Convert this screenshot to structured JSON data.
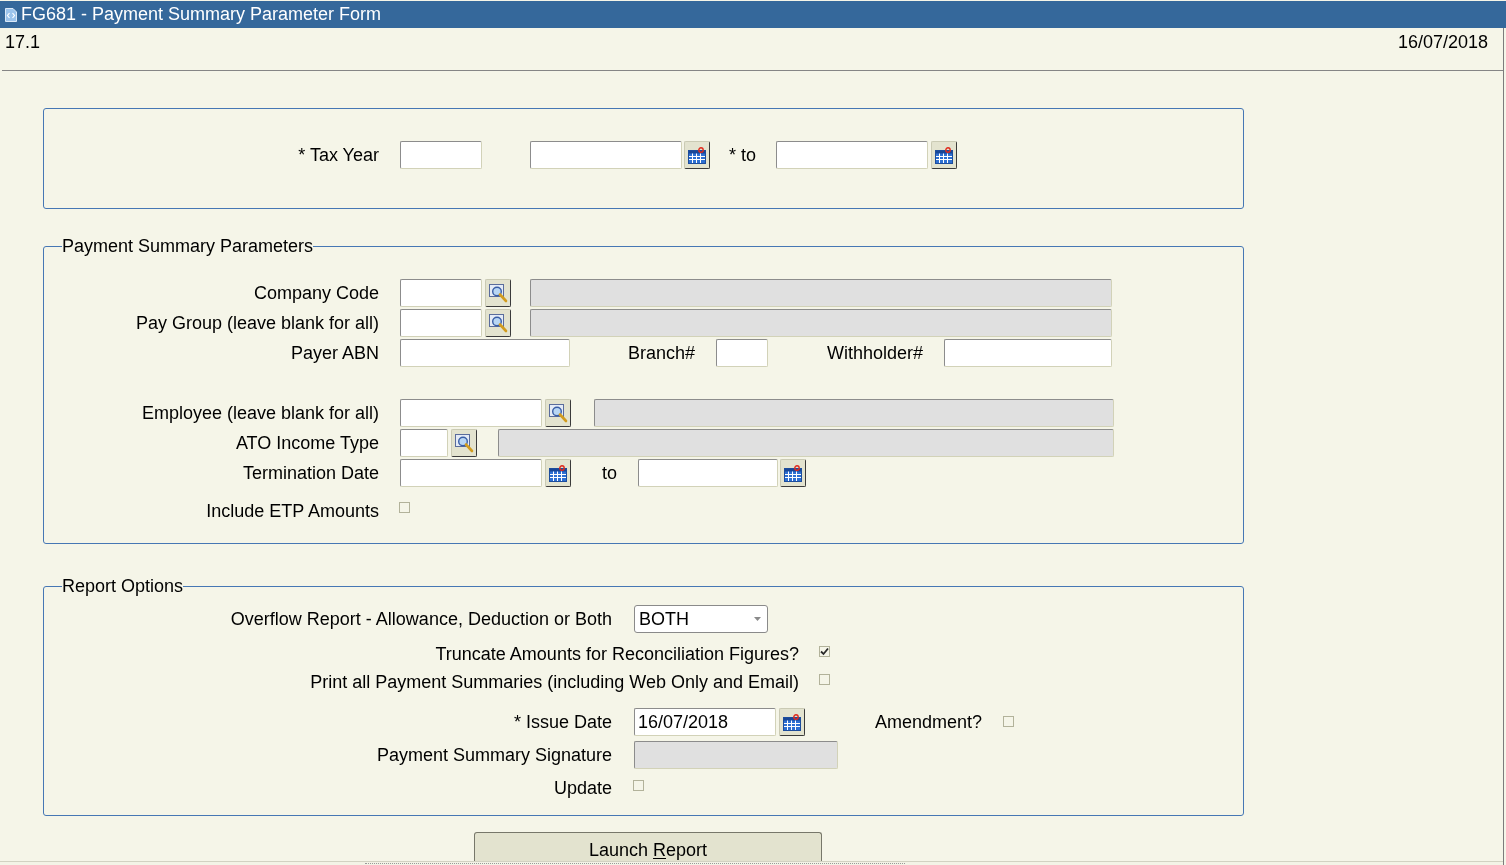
{
  "window": {
    "title": "FG681 - Payment Summary Parameter Form"
  },
  "header": {
    "version": "17.1",
    "date": "16/07/2018"
  },
  "tax_year_section": {
    "label": "* Tax Year",
    "to_label": "* to"
  },
  "payment_summary_parameters": {
    "legend": "Payment Summary Parameters",
    "company_code": {
      "label": "Company Code"
    },
    "pay_group": {
      "label": "Pay Group (leave blank for all)"
    },
    "payer_abn": {
      "label": "Payer ABN"
    },
    "branch": {
      "label": "Branch#"
    },
    "withholder": {
      "label": "Withholder#"
    },
    "employee": {
      "label": "Employee (leave blank for all)"
    },
    "ato_income_type": {
      "label": "ATO Income Type"
    },
    "termination_date": {
      "label": "Termination Date",
      "to_label": "to"
    },
    "include_etp_amounts": {
      "label": "Include ETP Amounts",
      "checked": false
    }
  },
  "report_options": {
    "legend": "Report Options",
    "overflow_report": {
      "label": "Overflow Report - Allowance, Deduction or Both",
      "value": "BOTH"
    },
    "truncate_amounts": {
      "label": "Truncate Amounts for Reconciliation Figures?",
      "checked": true
    },
    "print_all": {
      "label": "Print all Payment Summaries (including Web Only and Email)",
      "checked": false
    },
    "issue_date": {
      "label": "* Issue Date",
      "value": "16/07/2018"
    },
    "amendment": {
      "label": "Amendment?",
      "checked": false
    },
    "signature": {
      "label": "Payment Summary Signature",
      "disabled": true
    },
    "update": {
      "label": "Update",
      "checked": false
    }
  },
  "launch_button": {
    "label": [
      {
        "text": "Launch ",
        "underlined": false
      },
      {
        "text": "R",
        "underlined": true
      },
      {
        "text": "eport",
        "underlined": false
      }
    ]
  }
}
